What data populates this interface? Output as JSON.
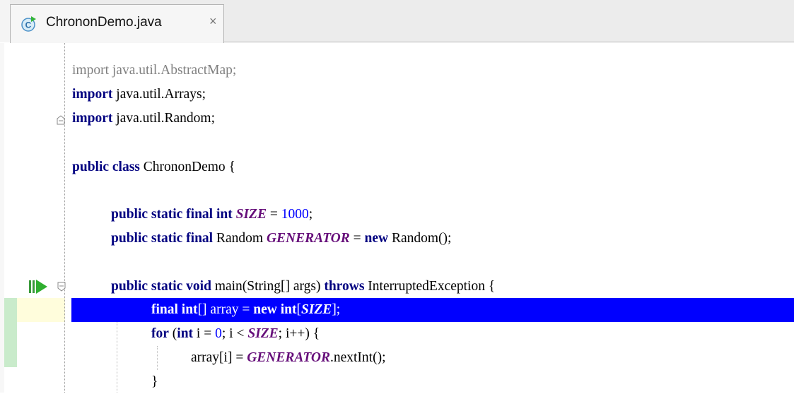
{
  "tab": {
    "filename": "ChrononDemo.java",
    "close_glyph": "×",
    "icon": "java-class-icon"
  },
  "colors": {
    "keyword": "#000080",
    "number": "#0000ff",
    "constant": "#660e7a",
    "unused_import": "#808080",
    "execution_line": "#0000ff",
    "current_line_gutter": "#fffddc",
    "change_marker": "#c9ebcb"
  },
  "code": {
    "line1": {
      "kw": "import",
      "rest": " java.util.AbstractMap;"
    },
    "line2": {
      "kw": "import",
      "rest": " java.util.Arrays;"
    },
    "line3": {
      "kw": "import",
      "rest": " java.util.Random;"
    },
    "line5": {
      "kw": "public class",
      "rest": " ChrononDemo {"
    },
    "line7": {
      "kw": "public static final int",
      "sp": " ",
      "const": "SIZE",
      "eq": " = ",
      "num": "1000",
      "end": ";"
    },
    "line8": {
      "kw": "public static final",
      "mid": " Random ",
      "const": "GENERATOR",
      "eq": " = ",
      "kw2": "new",
      "end": " Random();"
    },
    "line10": {
      "kw": "public static void",
      "mid": " main(String[] args) ",
      "kw2": "throws",
      "end": " InterruptedException {"
    },
    "line11": {
      "kw": "final int",
      "mid": "[] array = ",
      "kw2": "new int",
      "open": "[",
      "const": "SIZE",
      "end": "];"
    },
    "line12": {
      "kw": "for",
      "p1": " (",
      "kw2": "int",
      "p2": " i = ",
      "num": "0",
      "p3": "; i < ",
      "const": "SIZE",
      "end": "; i++) {"
    },
    "line13": {
      "start": "array[i] = ",
      "const": "GENERATOR",
      "end": ".nextInt();"
    },
    "line14": {
      "text": "}"
    }
  }
}
